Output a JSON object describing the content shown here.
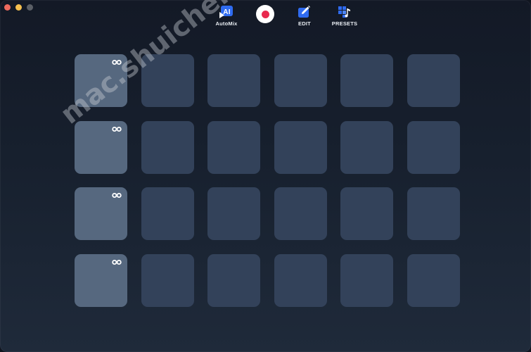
{
  "toolbar": {
    "automix_label": "AutoMix",
    "edit_label": "EDIT",
    "presets_label": "PRESETS",
    "automix_icon_text": "AI"
  },
  "colors": {
    "record_dot": "#e8294e",
    "accent_blue": "#2f6bf0",
    "pad_inactive": "#33425a",
    "pad_active": "#56687f"
  },
  "pads": [
    {
      "active": true,
      "loop": true
    },
    {
      "active": false,
      "loop": false
    },
    {
      "active": false,
      "loop": false
    },
    {
      "active": false,
      "loop": false
    },
    {
      "active": false,
      "loop": false
    },
    {
      "active": false,
      "loop": false
    },
    {
      "active": true,
      "loop": true
    },
    {
      "active": false,
      "loop": false
    },
    {
      "active": false,
      "loop": false
    },
    {
      "active": false,
      "loop": false
    },
    {
      "active": false,
      "loop": false
    },
    {
      "active": false,
      "loop": false
    },
    {
      "active": true,
      "loop": true
    },
    {
      "active": false,
      "loop": false
    },
    {
      "active": false,
      "loop": false
    },
    {
      "active": false,
      "loop": false
    },
    {
      "active": false,
      "loop": false
    },
    {
      "active": false,
      "loop": false
    },
    {
      "active": true,
      "loop": true
    },
    {
      "active": false,
      "loop": false
    },
    {
      "active": false,
      "loop": false
    },
    {
      "active": false,
      "loop": false
    },
    {
      "active": false,
      "loop": false
    },
    {
      "active": false,
      "loop": false
    }
  ],
  "watermark": "mac.shuiche.cc"
}
